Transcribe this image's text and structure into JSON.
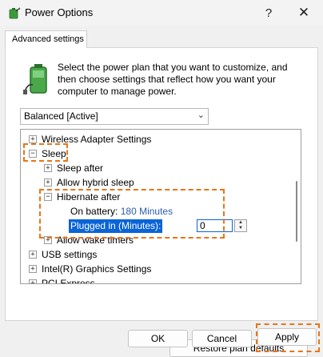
{
  "window": {
    "title": "Power Options",
    "help_glyph": "?",
    "close_glyph": "✕"
  },
  "tab": {
    "label": "Advanced settings"
  },
  "description": "Select the power plan that you want to customize, and then choose settings that reflect how you want your computer to manage power.",
  "plan": {
    "selected": "Balanced [Active]"
  },
  "tree": {
    "items": [
      {
        "label": "Wireless Adapter Settings",
        "expander": "+"
      },
      {
        "label": "Sleep",
        "expander": "−"
      },
      {
        "label": "Sleep after",
        "expander": "+"
      },
      {
        "label": "Allow hybrid sleep",
        "expander": "+"
      },
      {
        "label": "Hibernate after",
        "expander": "−"
      },
      {
        "label": "Allow wake timers",
        "expander": "+"
      },
      {
        "label": "USB settings",
        "expander": "+"
      },
      {
        "label": "Intel(R) Graphics Settings",
        "expander": "+"
      },
      {
        "label": "PCI Express",
        "expander": "+"
      }
    ],
    "on_battery_label": "On battery:",
    "on_battery_value": "180 Minutes",
    "plugged_in_label": "Plugged in (Minutes):",
    "plugged_in_value": "0"
  },
  "buttons": {
    "restore": "Restore plan defaults",
    "ok": "OK",
    "cancel": "Cancel",
    "apply": "Apply"
  },
  "colors": {
    "highlight_dash": "#e8751a",
    "selection": "#0a64d6",
    "link": "#2a5db0"
  }
}
